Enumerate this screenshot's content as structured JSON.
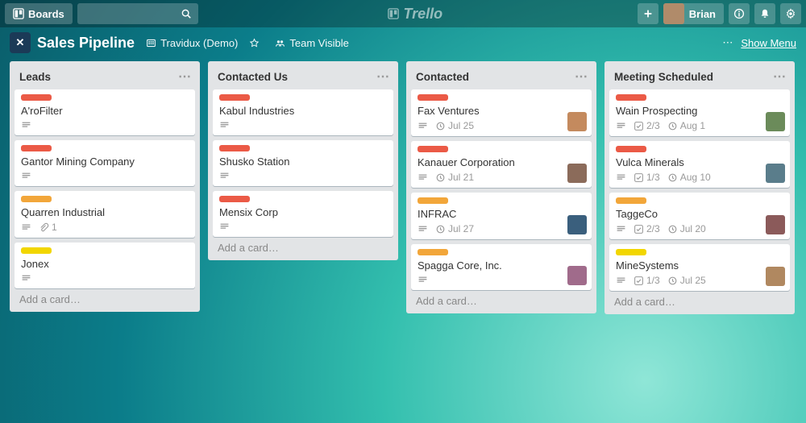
{
  "nav": {
    "boards_label": "Boards",
    "logo_text": "Trello",
    "user_name": "Brian"
  },
  "board_header": {
    "title": "Sales Pipeline",
    "org": "Travidux (Demo)",
    "visibility": "Team Visible",
    "show_menu": "Show Menu"
  },
  "add_card_text": "Add a card…",
  "label_colors": {
    "orange": "#eb5a46",
    "amber": "#f2a63a",
    "yellow": "#f2d600"
  },
  "member_colors": [
    "#c48a5e",
    "#8b6b5a",
    "#3a5f7d",
    "#a06b8b",
    "#6b8b5a",
    "#5a7d8b",
    "#8b5a5a",
    "#b08860"
  ],
  "lists": [
    {
      "title": "Leads",
      "cards": [
        {
          "label": "orange",
          "title": "A'roFilter",
          "desc": true
        },
        {
          "label": "orange",
          "title": "Gantor Mining Company",
          "desc": true
        },
        {
          "label": "amber",
          "title": "Quarren Industrial",
          "desc": true,
          "attach": "1"
        },
        {
          "label": "yellow",
          "title": "Jonex",
          "desc": true
        }
      ]
    },
    {
      "title": "Contacted Us",
      "cards": [
        {
          "label": "orange",
          "title": "Kabul Industries",
          "desc": true
        },
        {
          "label": "orange",
          "title": "Shusko Station",
          "desc": true
        },
        {
          "label": "orange",
          "title": "Mensix Corp",
          "desc": true
        }
      ]
    },
    {
      "title": "Contacted",
      "cards": [
        {
          "label": "orange",
          "title": "Fax Ventures",
          "desc": true,
          "due": "Jul 25",
          "member": 0
        },
        {
          "label": "orange",
          "title": "Kanauer Corporation",
          "desc": true,
          "due": "Jul 21",
          "member": 1
        },
        {
          "label": "amber",
          "title": "INFRAC",
          "desc": true,
          "due": "Jul 27",
          "member": 2
        },
        {
          "label": "amber",
          "title": "Spagga Core, Inc.",
          "desc": true,
          "member": 3
        }
      ]
    },
    {
      "title": "Meeting Scheduled",
      "cards": [
        {
          "label": "orange",
          "title": "Wain Prospecting",
          "desc": true,
          "check": "2/3",
          "due": "Aug 1",
          "member": 4
        },
        {
          "label": "orange",
          "title": "Vulca Minerals",
          "desc": true,
          "check": "1/3",
          "due": "Aug 10",
          "member": 5
        },
        {
          "label": "amber",
          "title": "TaggeCo",
          "desc": true,
          "check": "2/3",
          "due": "Jul 20",
          "member": 6
        },
        {
          "label": "yellow",
          "title": "MineSystems",
          "desc": true,
          "check": "1/3",
          "due": "Jul 25",
          "member": 7
        }
      ]
    }
  ]
}
